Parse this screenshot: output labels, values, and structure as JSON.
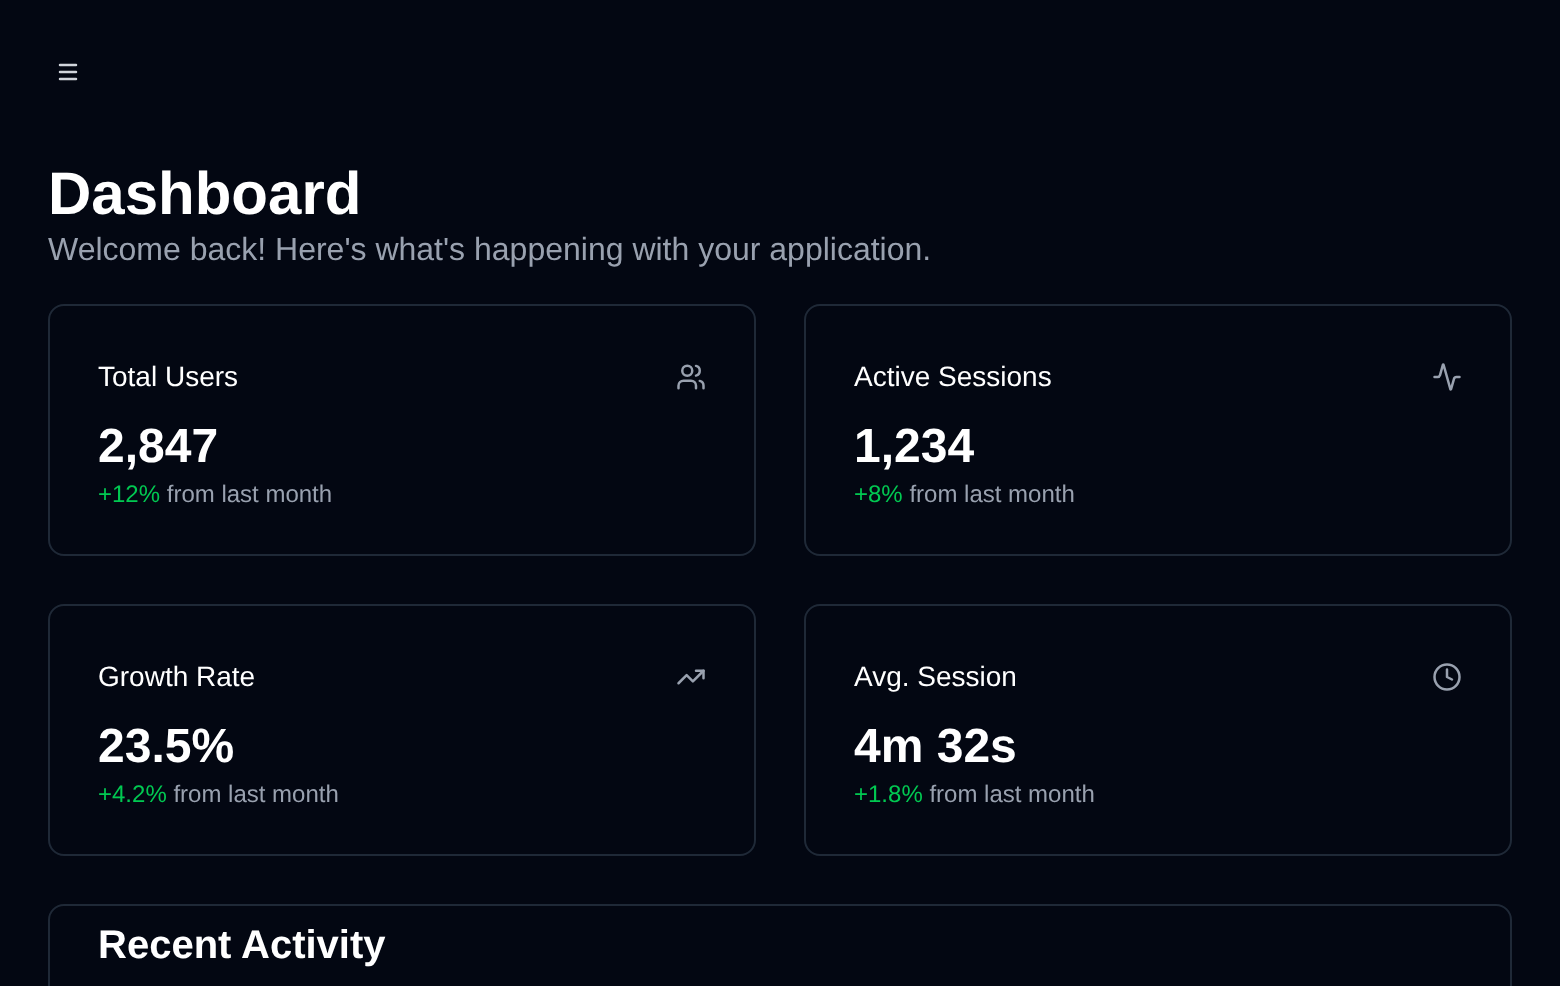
{
  "title": "Dashboard",
  "subtitle": "Welcome back! Here's what's happening with your application.",
  "stats": [
    {
      "label": "Total Users",
      "value": "2,847",
      "change": "+12%",
      "note": "from last month"
    },
    {
      "label": "Active Sessions",
      "value": "1,234",
      "change": "+8%",
      "note": "from last month"
    },
    {
      "label": "Growth Rate",
      "value": "23.5%",
      "change": "+4.2%",
      "note": "from last month"
    },
    {
      "label": "Avg. Session",
      "value": "4m 32s",
      "change": "+1.8%",
      "note": "from last month"
    }
  ],
  "recent_activity": {
    "title": "Recent Activity"
  }
}
